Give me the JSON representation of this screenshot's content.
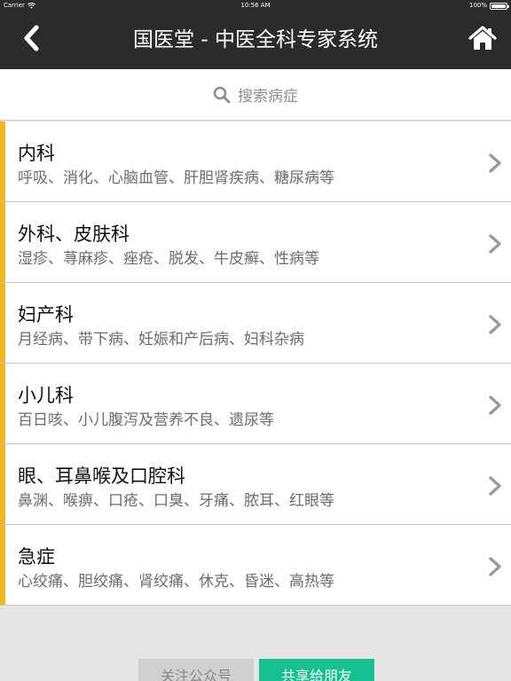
{
  "status_bar": {
    "carrier": "Carrier",
    "time": "10:56 AM",
    "battery": "100%",
    "battery_level": 1.0
  },
  "nav": {
    "title": "国医堂 - 中医全科专家系统",
    "back_icon": "chevron-left-icon",
    "home_icon": "home-icon"
  },
  "search": {
    "placeholder": "搜索病症",
    "icon": "search-icon"
  },
  "categories": [
    {
      "title": "内科",
      "subtitle": "呼吸、消化、心脑血管、肝胆肾疾病、糖尿病等"
    },
    {
      "title": "外科、皮肤科",
      "subtitle": "湿疹、荨麻疹、痤疮、脱发、牛皮癣、性病等"
    },
    {
      "title": "妇产科",
      "subtitle": "月经病、带下病、妊娠和产后病、妇科杂病"
    },
    {
      "title": "小儿科",
      "subtitle": "百日咳、小儿腹泻及营养不良、遗尿等"
    },
    {
      "title": "眼、耳鼻喉及口腔科",
      "subtitle": "鼻渊、喉痹、口疮、口臭、牙痛、脓耳、红眼等"
    },
    {
      "title": "急症",
      "subtitle": "心绞痛、胆绞痛、肾绞痛、休克、昏迷、高热等"
    }
  ],
  "footer": {
    "follow_label": "关注公众号",
    "share_label": "共享给朋友"
  },
  "colors": {
    "nav_bg": "#2b2b2b",
    "accent_bar": "#f1b722",
    "share_button": "#16c18f",
    "follow_button": "#d0d0d0"
  }
}
